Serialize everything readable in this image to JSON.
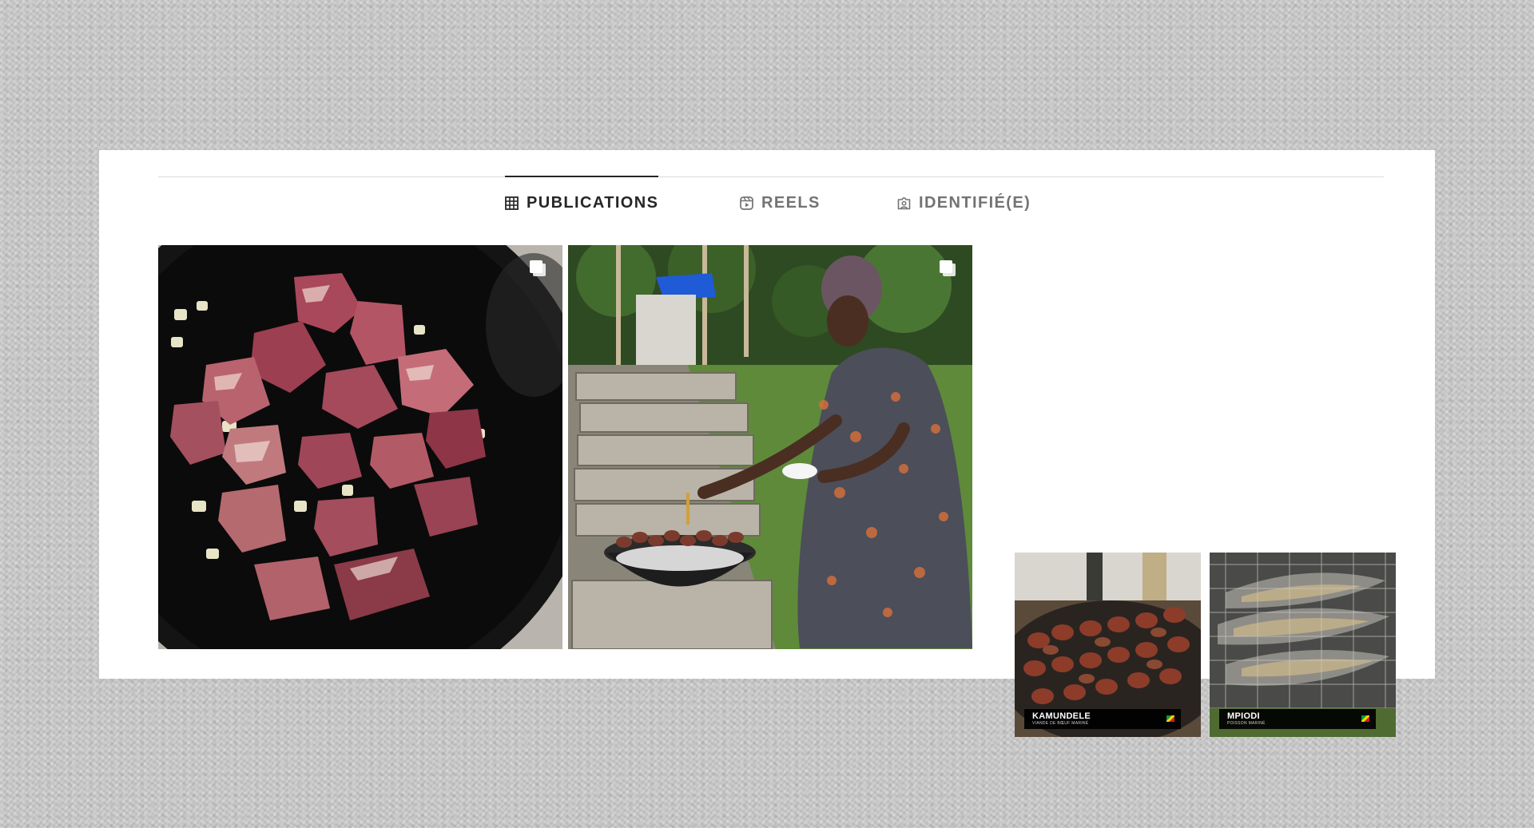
{
  "tabs": [
    {
      "label": "PUBLICATIONS",
      "icon": "grid-icon",
      "active": true
    },
    {
      "label": "REELS",
      "icon": "reels-icon",
      "active": false
    },
    {
      "label": "IDENTIFIÉ(E)",
      "icon": "tagged-icon",
      "active": false
    }
  ],
  "posts": [
    {
      "subject": "raw meat pieces with diced onion in black pot",
      "icon": "carousel-icon"
    },
    {
      "subject": "woman grilling skewers on barbecue outdoors",
      "icon": "carousel-icon"
    }
  ],
  "thumbnails": [
    {
      "title": "KAMUNDELE",
      "subtitle": "VIANDE DE BŒUF MARINÉ"
    },
    {
      "title": "MPIODI",
      "subtitle": "POISSON MARINÉ"
    }
  ],
  "colors": {
    "active_tab": "#262626",
    "inactive_tab": "#737373",
    "divider": "#dbdbdb",
    "background": "#c9c9c9"
  }
}
